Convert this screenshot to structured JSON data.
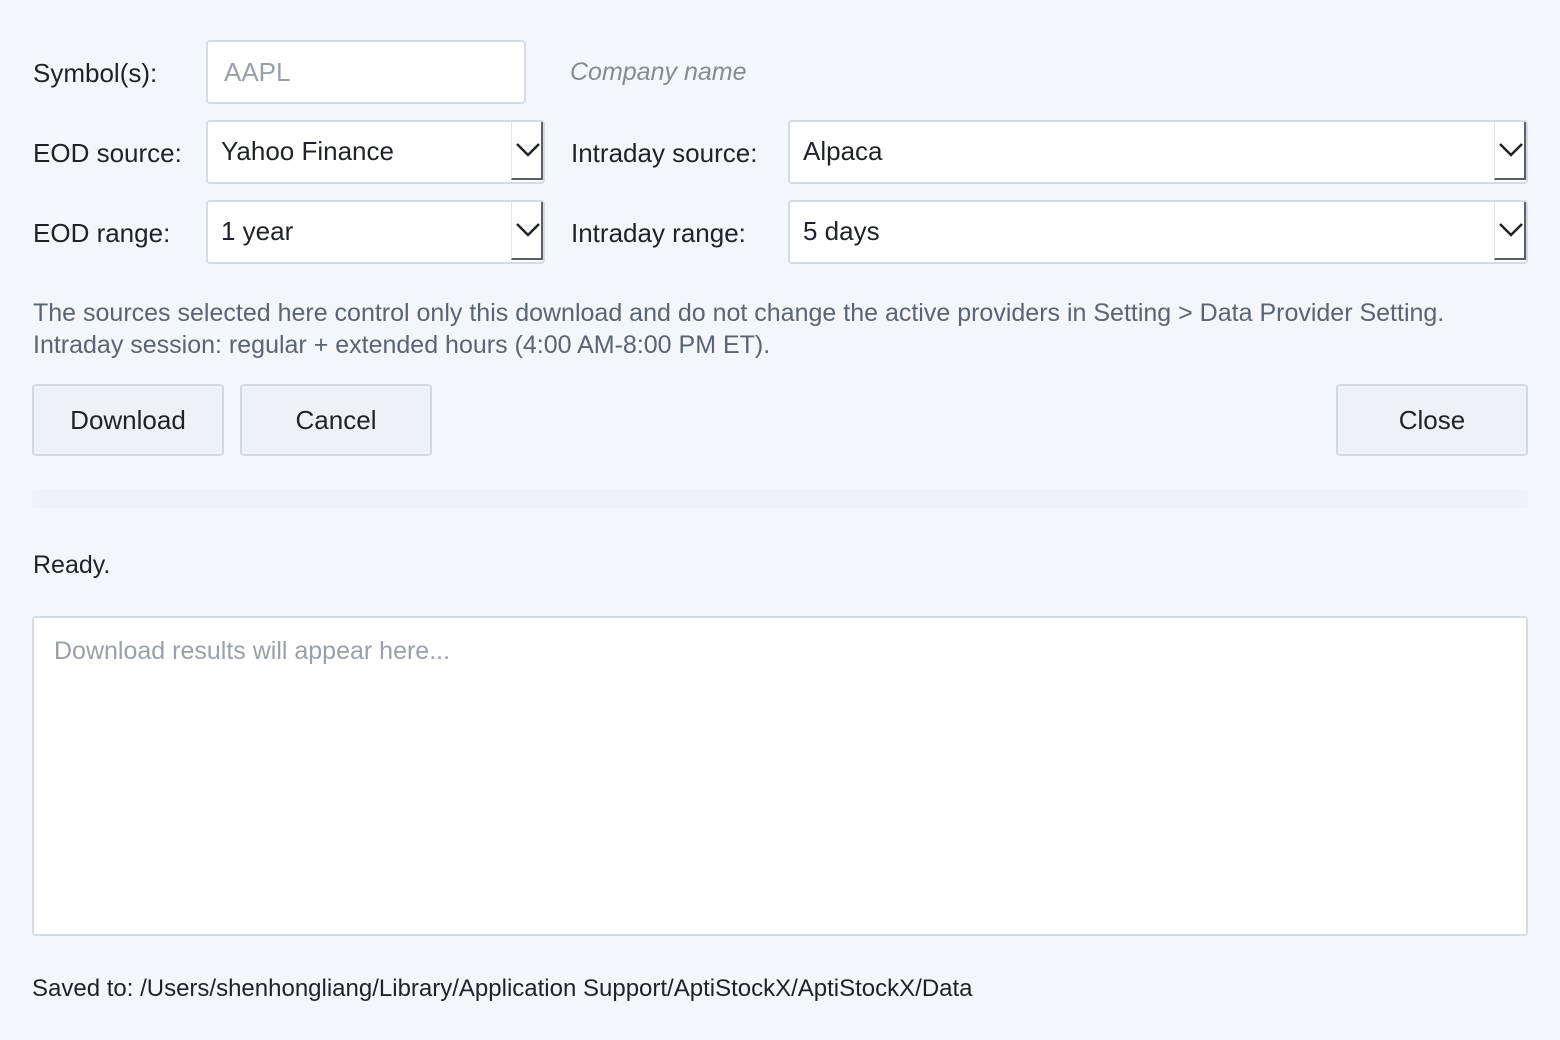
{
  "form": {
    "symbol_label": "Symbol(s):",
    "symbol_value": "",
    "symbol_placeholder": "AAPL",
    "company_name": "Company name",
    "eod_source_label": "EOD source:",
    "eod_source_value": "Yahoo Finance",
    "intraday_source_label": "Intraday source:",
    "intraday_source_value": "Alpaca",
    "eod_range_label": "EOD range:",
    "eod_range_value": "1 year",
    "intraday_range_label": "Intraday range:",
    "intraday_range_value": "5 days"
  },
  "info": {
    "text": "The sources selected here control only this download and do not change the active providers in Setting > Data Provider Setting. Intraday session: regular + extended hours (4:00 AM-8:00 PM ET)."
  },
  "buttons": {
    "download": "Download",
    "cancel": "Cancel",
    "close": "Close"
  },
  "progress": {
    "value": 0
  },
  "status": {
    "text": "Ready."
  },
  "results": {
    "placeholder": "Download results will appear here..."
  },
  "footer": {
    "saved_to": "Saved to: /Users/shenhongliang/Library/Application Support/AptiStockX/AptiStockX/Data"
  },
  "icons": {
    "dropdown": "chevron-down-icon"
  },
  "colors": {
    "background": "#f3f6fa",
    "info_text": "#5b6472",
    "placeholder": "#9aa0a8"
  }
}
